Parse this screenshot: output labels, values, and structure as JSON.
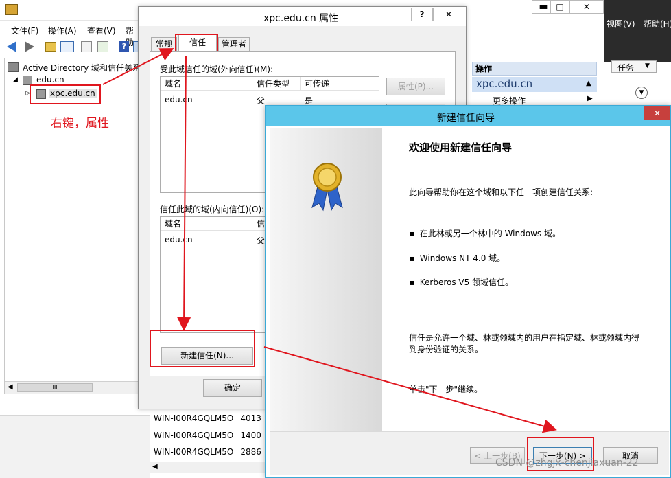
{
  "mmc": {
    "menu": [
      "文件(F)",
      "操作(A)",
      "查看(V)",
      "帮助"
    ],
    "tree": {
      "root": "Active Directory 域和信任关系",
      "domain": "edu.cn",
      "child": "xpc.edu.cn"
    },
    "right_menu": [
      "视图(V)",
      "帮助(H)"
    ],
    "task_label": "任务",
    "actions": {
      "header": "操作",
      "section": "xpc.edu.cn",
      "more": "更多操作"
    },
    "list_rows": [
      {
        "name": "WIN-I00R4GQLM5O",
        "num": "4013"
      },
      {
        "name": "WIN-I00R4GQLM5O",
        "num": "1400"
      },
      {
        "name": "WIN-I00R4GQLM5O",
        "num": "2886"
      }
    ],
    "scroll_mark": "III"
  },
  "annotation": "右键，属性",
  "props": {
    "title": "xpc.edu.cn 属性",
    "help": "?",
    "close": "✕",
    "tabs": [
      "常规",
      "信任",
      "管理者"
    ],
    "outgoing_label": "受此域信任的域(外向信任)(M):",
    "columns": [
      "域名",
      "信任类型",
      "可传递"
    ],
    "outgoing_rows": [
      {
        "domain": "edu.cn",
        "type": "父",
        "transitive": "是"
      }
    ],
    "properties_button": "属性(P)...",
    "incoming_label": "信任此域的域(内向信任)(O):",
    "incoming_columns": [
      "域名",
      "信"
    ],
    "incoming_rows": [
      {
        "domain": "edu.cn",
        "type": "父"
      }
    ],
    "new_trust_button": "新建信任(N)...",
    "ok_button": "确定"
  },
  "wizard": {
    "title": "新建信任向导",
    "close": "✕",
    "heading": "欢迎使用新建信任向导",
    "intro": "此向导帮助你在这个域和以下任一项创建信任关系:",
    "bullets": [
      "在此林或另一个林中的 Windows 域。",
      "Windows NT 4.0 域。",
      "Kerberos V5 领域信任。"
    ],
    "para1": "信任是允许一个域、林或领域内的用户在指定域、林或领域内得到身份验证的关系。",
    "para2": "单击\"下一步\"继续。",
    "back_button": "< 上一步(B)",
    "next_button": "下一步(N) >",
    "cancel_button": "取消"
  },
  "watermark": "CSDN @zhgjx-chenjiaxuan-22",
  "colors": {
    "accent_red": "#e0161e",
    "wizard_title_bg": "#5bc6ea",
    "selection": "#cce8ff"
  }
}
